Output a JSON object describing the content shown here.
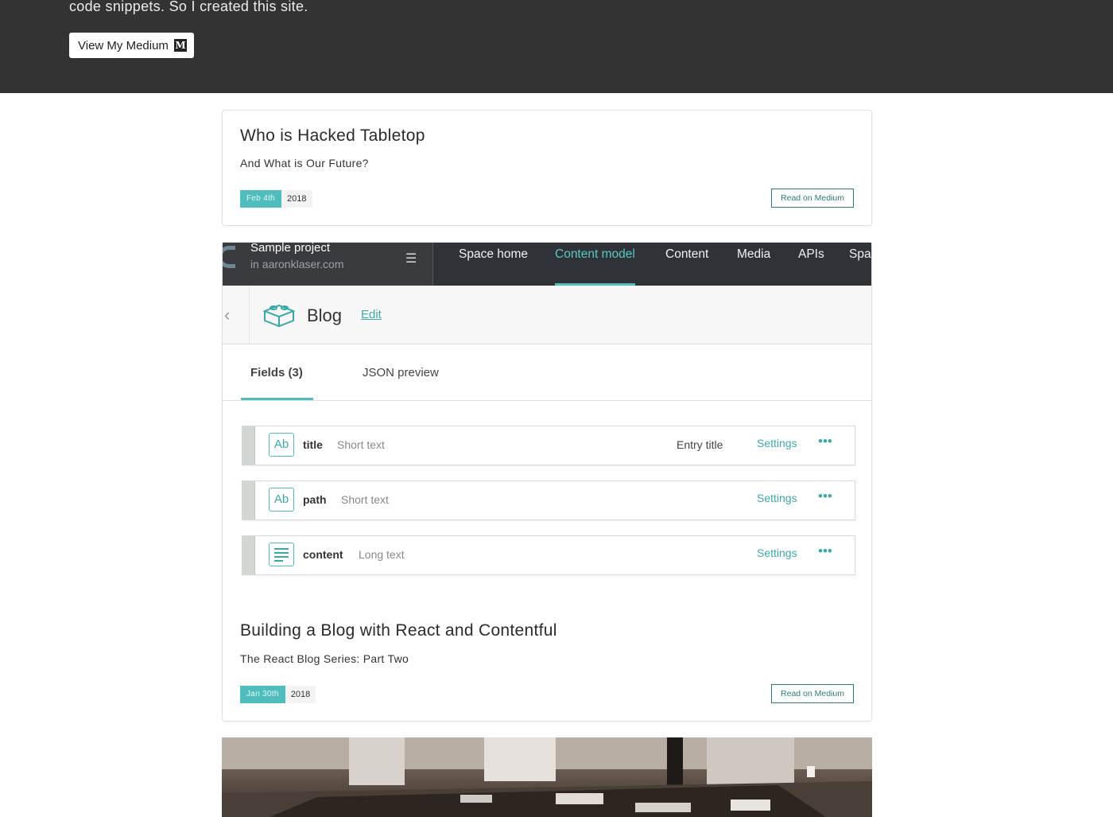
{
  "hero": {
    "text": "code snippets. So I created this site.",
    "medium_button": "View My Medium",
    "medium_logo": "M"
  },
  "posts": [
    {
      "title": "Who is Hacked Tabletop",
      "subtitle": "And What is Our Future?",
      "date": "Feb 4th",
      "year": "2018",
      "read_label": "Read on Medium"
    },
    {
      "title": "Building a Blog with React and Contentful",
      "subtitle": "The React Blog Series: Part Two",
      "date": "Jan 30th",
      "year": "2018",
      "read_label": "Read on Medium"
    }
  ],
  "contentful": {
    "project_name": "Sample project",
    "project_site": "in aaronklaser.com",
    "nav": [
      "Space home",
      "Content model",
      "Content",
      "Media",
      "APIs",
      "Spa"
    ],
    "content_type": "Blog",
    "edit_label": "Edit",
    "tabs": [
      "Fields (3)",
      "JSON preview"
    ],
    "fields": [
      {
        "icon": "Ab",
        "name": "title",
        "type": "Short text",
        "extra": "Entry title",
        "settings": "Settings",
        "dots": "•••"
      },
      {
        "icon": "Ab",
        "name": "path",
        "type": "Short text",
        "settings": "Settings",
        "dots": "•••"
      },
      {
        "icon": "lines",
        "name": "content",
        "type": "Long text",
        "settings": "Settings",
        "dots": "•••"
      }
    ]
  },
  "colors": {
    "hero_bg": "#333334",
    "accent": "#4fbdbb",
    "read_button": "#2b7b79"
  }
}
